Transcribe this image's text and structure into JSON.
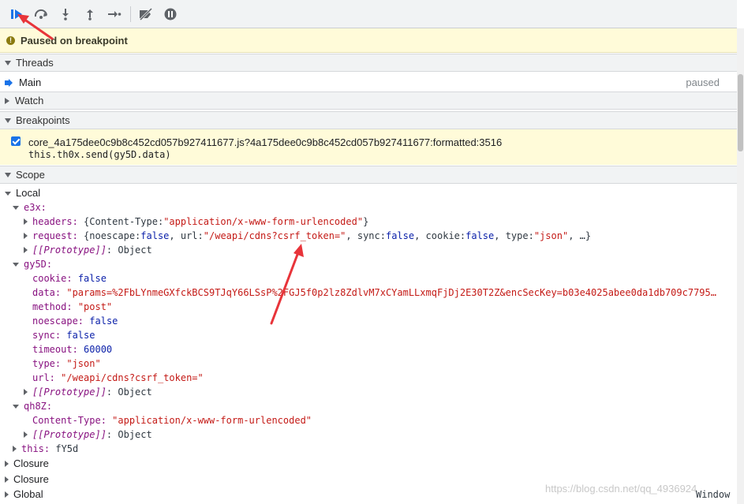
{
  "toolbar": {
    "buttons": [
      "resume-icon",
      "step-over-icon",
      "step-into-icon",
      "step-out-icon",
      "step-icon",
      "deactivate-breakpoints-icon",
      "pause-on-exceptions-icon"
    ]
  },
  "paused": {
    "message": "Paused on breakpoint"
  },
  "threads": {
    "header": "Threads",
    "main_label": "Main",
    "main_status": "paused"
  },
  "watch": {
    "header": "Watch"
  },
  "breakpoints": {
    "header": "Breakpoints",
    "file": "core_4a175dee0c9b8c452cd057b927411677.js?4a175dee0c9b8c452cd057b927411677:formatted:3516",
    "code": "this.th0x.send(gy5D.data)"
  },
  "scope": {
    "header": "Scope",
    "local": "Local",
    "e3x": "e3x:",
    "e3x_headers_key": "headers:",
    "e3x_headers_val_pre": "{Content-Type: ",
    "e3x_headers_val_str": "\"application/x-www-form-urlencoded\"",
    "e3x_headers_val_post": "}",
    "e3x_request_key": "request:",
    "e3x_request_pre": "{noescape: ",
    "e3x_request_false1": "false",
    "e3x_request_url": ", url: ",
    "e3x_request_url_str": "\"/weapi/cdns?csrf_token=\"",
    "e3x_request_sync": ", sync: ",
    "e3x_request_false2": "false",
    "e3x_request_cookie": ", cookie: ",
    "e3x_request_false3": "false",
    "e3x_request_type": ", type: ",
    "e3x_request_type_str": "\"json\"",
    "e3x_request_end": ", …}",
    "proto_key": "[[Prototype]]",
    "proto_val": ": Object",
    "gy5D": "gy5D:",
    "cookie_key": "cookie:",
    "cookie_val": "false",
    "data_key": "data:",
    "data_val": "\"params=%2FbLYnmeGXfckBCS9TJqY66LSsP%2FGJ5f0p2lz8ZdlvM7xCYamLLxmqFjDj2E30T2Z&encSecKey=b03e4025abee0da1db709c7795…",
    "method_key": "method:",
    "method_val": "\"post\"",
    "noescape_key": "noescape:",
    "noescape_val": "false",
    "sync_key": "sync:",
    "sync_val": "false",
    "timeout_key": "timeout:",
    "timeout_val": "60000",
    "type_key": "type:",
    "type_val": "\"json\"",
    "url_key": "url:",
    "url_val": "\"/weapi/cdns?csrf_token=\"",
    "qh8Z": "qh8Z:",
    "ct_key": "Content-Type:",
    "ct_val": "\"application/x-www-form-urlencoded\"",
    "this_key": "this:",
    "this_val": "fY5d",
    "closure1": "Closure",
    "closure2": "Closure",
    "global": "Global",
    "global_val": "Window"
  },
  "watermark": "https://blog.csdn.net/qq_4936924",
  "colors": {
    "accent": "#1a73e8",
    "paused_bg": "#fffbd9",
    "annotation_arrow": "#e8343a"
  }
}
